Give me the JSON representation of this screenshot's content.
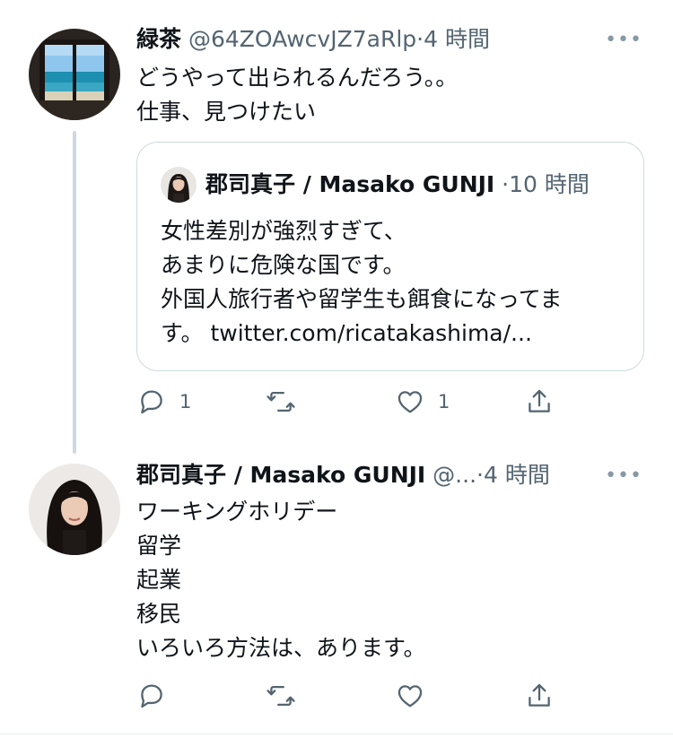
{
  "tweet1": {
    "name": "緑茶",
    "handle": "@64ZOAwcvJZ7aRlp",
    "dot": "·",
    "time": "4 時間",
    "more": "•••",
    "lines": [
      "どうやって出られるんだろう。。",
      "仕事、見つけたい"
    ],
    "quote": {
      "name": "郡司真子 / Masako GUNJI",
      "dot": "·",
      "time": "10 時間",
      "lines": [
        "女性差別が強烈すぎて、",
        "あまりに危険な国です。",
        "外国人旅行者や留学生も餌食になってま",
        "す。 twitter.com/ricatakashima/..."
      ]
    },
    "actions": {
      "reply_count": "1",
      "retweet_count": "",
      "like_count": "1"
    }
  },
  "tweet2": {
    "name": "郡司真子 / Masako GUNJI",
    "handle": "@...",
    "dot": "·",
    "time": "4 時間",
    "more": "•••",
    "lines": [
      "ワーキングホリデー",
      "留学",
      "起業",
      "移民",
      "いろいろ方法は、あります。"
    ]
  },
  "colors": {
    "text": "#0f1419",
    "secondary": "#536471",
    "border": "#cfd9de",
    "icon": "#536471"
  },
  "icons": [
    "reply-icon",
    "retweet-icon",
    "like-icon",
    "share-icon",
    "more-icon"
  ]
}
